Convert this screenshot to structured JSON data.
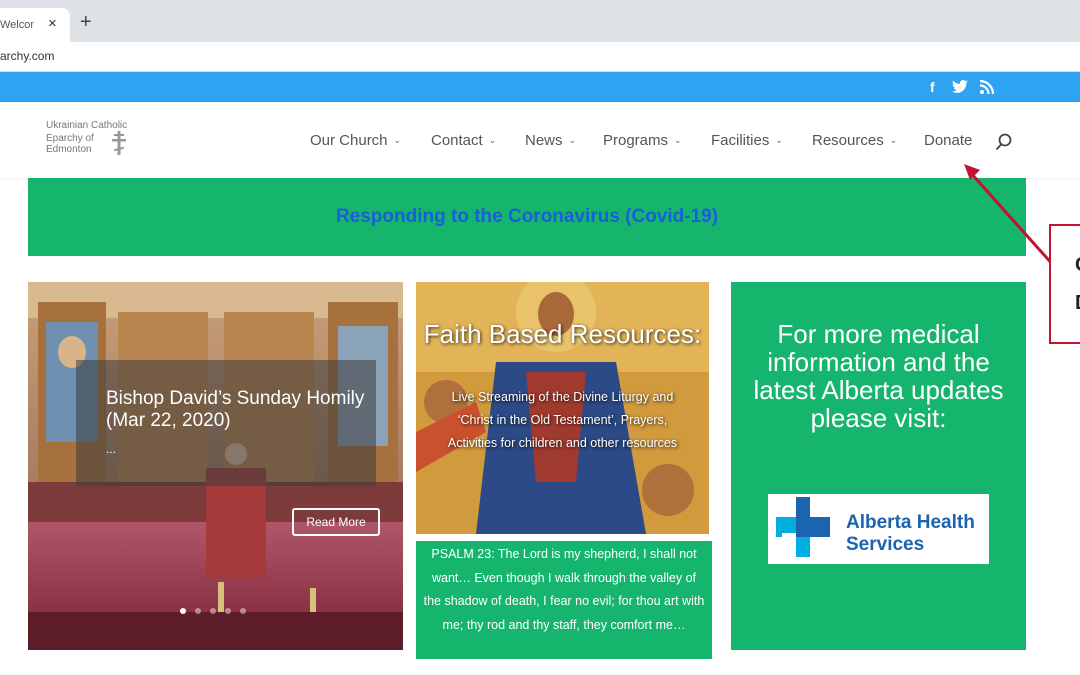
{
  "browser": {
    "tab_title": "Welcome to",
    "tab_close": "×",
    "new_tab": "+",
    "url": "archy.com"
  },
  "social": {
    "facebook": "f",
    "twitter": "twitter-icon",
    "rss": "rss-icon"
  },
  "logo": {
    "line1": "Ukrainian Catholic",
    "line2": "Eparchy of",
    "line3": "Edmonton"
  },
  "nav": [
    {
      "label": "Our Church",
      "has_dropdown": true
    },
    {
      "label": "Contact",
      "has_dropdown": true
    },
    {
      "label": "News",
      "has_dropdown": true
    },
    {
      "label": "Programs",
      "has_dropdown": true
    },
    {
      "label": "Facilities",
      "has_dropdown": true
    },
    {
      "label": "Resources",
      "has_dropdown": true
    },
    {
      "label": "Donate",
      "has_dropdown": false
    }
  ],
  "banner": {
    "link_text": "Responding to the Coronavirus (Covid-19)"
  },
  "slider": {
    "title": "Bishop David’s Sunday Homily (Mar 22, 2020)",
    "ellipsis": "...",
    "read_more": "Read More",
    "slide_count": 5,
    "active_slide": 1
  },
  "faith_card": {
    "title": "Faith Based Resources:",
    "description": "Live Streaming of the Divine Liturgy and ‘Christ in the Old Testament’, Prayers, Activities for children and other resources"
  },
  "psalm": {
    "text": "PSALM 23: The Lord is my shepherd, I shall not want… Even though I walk through the valley of the shadow of death, I fear no evil; for thou art with me; thy rod and thy staff, they comfort me…"
  },
  "medical_card": {
    "text": "For more medical information and the latest Alberta updates please visit:",
    "ahs_line1": "Alberta Health",
    "ahs_line2": "Services"
  },
  "callout": {
    "line1": "C",
    "line2": "D"
  },
  "colors": {
    "accent_blue": "#2ea3f2",
    "green": "#16b56e",
    "banner_link": "#1a5fd6",
    "ahs_blue": "#1b64b0",
    "ahs_cyan": "#00aee0",
    "callout_red": "#c4122f"
  }
}
